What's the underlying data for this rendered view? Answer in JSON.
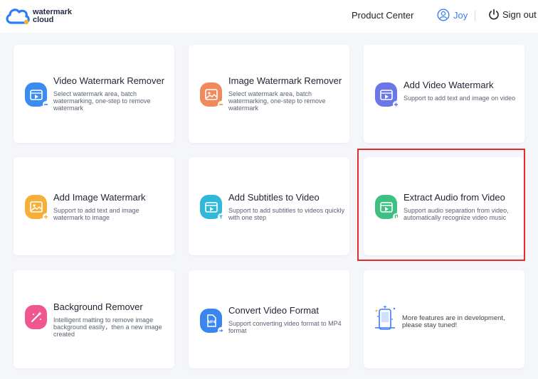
{
  "header": {
    "logo_line1": "watermark",
    "logo_line2": "cloud",
    "product_center": "Product Center",
    "user_name": "Joy",
    "sign_out": "Sign out"
  },
  "cards": [
    {
      "title": "Video Watermark Remover",
      "desc": "Select watermark area, batch watermarking, one-step to remove watermark",
      "icon": "video-remove-icon",
      "color": "#3b8cf0"
    },
    {
      "title": "Image Watermark Remover",
      "desc": "Select watermark area, batch watermarking, one-step to remove watermark",
      "icon": "image-remove-icon",
      "color": "#f08a5d"
    },
    {
      "title": "Add Video Watermark",
      "desc": "Support to add text and image on video",
      "icon": "video-add-icon",
      "color": "#6b76e8"
    },
    {
      "title": "Add Image Watermark",
      "desc": "Support to add text and image watermark to image",
      "icon": "image-add-icon",
      "color": "#f6b03a"
    },
    {
      "title": "Add Subtitles to Video",
      "desc": "Support to add subtitles to videos quickly with one step",
      "icon": "subtitles-icon",
      "color": "#2fb8d8"
    },
    {
      "title": "Extract Audio from Video",
      "desc": "Support audio separation from video, automatically recognize video music",
      "icon": "audio-extract-icon",
      "color": "#3fbf82"
    },
    {
      "title": "Background Remover",
      "desc": "Intelligent matting to remove image background easily，then a new image created",
      "icon": "background-remover-icon",
      "color": "#f0578e"
    },
    {
      "title": "Convert Video Format",
      "desc": "Support converting video format to MP4 format",
      "icon": "mp4-convert-icon",
      "color": "#3a86ee",
      "icon_text": "MP4"
    }
  ],
  "dev_card": {
    "text": "More features are in development, please stay tuned!",
    "icon": "in-development-icon"
  },
  "highlighted_card": "Extract Audio from Video"
}
